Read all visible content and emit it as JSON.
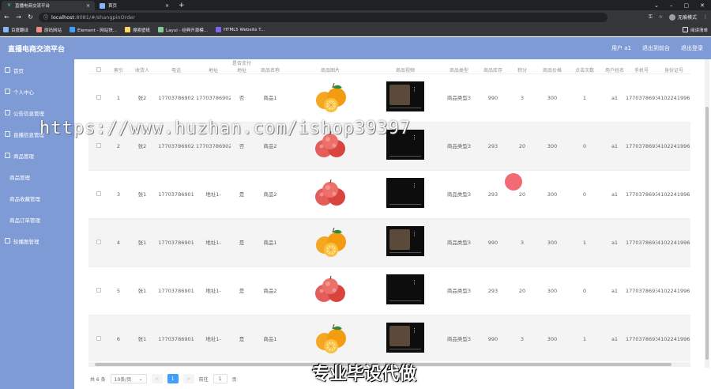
{
  "browser": {
    "tabs": [
      {
        "title": "直播电商交流平台",
        "active": true
      },
      {
        "title": "首页",
        "active": false
      }
    ],
    "url_host": "localhost",
    "url_path": ":8081/#/shangpinOrder",
    "profile_label": "无痕模式",
    "bookmarks": [
      "百度翻译",
      "原码网站",
      "Element - 网站快...",
      "搜索壁纸",
      "Layui - 经典开源模...",
      "HTML5 Website T..."
    ],
    "reading_list": "阅读清单"
  },
  "header": {
    "title": "直播电商交流平台",
    "links": [
      "用户 a1",
      "退出到前台",
      "退出登录"
    ]
  },
  "sidebar": {
    "items": [
      {
        "label": "首页",
        "sub": false
      },
      {
        "label": "个人中心",
        "sub": false
      },
      {
        "label": "公告信息管理",
        "sub": false
      },
      {
        "label": "直播信息管理",
        "sub": false
      },
      {
        "label": "商品管理",
        "sub": false
      },
      {
        "label": "商品管理",
        "sub": true
      },
      {
        "label": "商品收藏管理",
        "sub": true
      },
      {
        "label": "商品订单管理",
        "sub": true
      },
      {
        "label": "轮播图管理",
        "sub": false
      }
    ]
  },
  "table": {
    "columns": [
      "",
      "索引",
      "收货人",
      "电话",
      "地址",
      "是否支付地址",
      "商品名称",
      "商品图片",
      "商品视频",
      "商品类型",
      "商品库存",
      "积分",
      "商品价格",
      "点击次数",
      "用户姓名",
      "手机号",
      "身份证号"
    ],
    "rows": [
      {
        "idx": "1",
        "name": "张2",
        "phone": "17703786902",
        "addr": "17703786902",
        "paid": "否",
        "product": "商品1",
        "img": "orange",
        "type": "商品类型3",
        "stock": "990",
        "points": "3",
        "price": "300",
        "clicks": "1",
        "user": "a1",
        "mobile": "17703786931",
        "idcard": "410224199610232001"
      },
      {
        "idx": "2",
        "name": "张2",
        "phone": "17703786902",
        "addr": "17703786902",
        "paid": "否",
        "product": "商品2",
        "img": "apple",
        "type": "商品类型3",
        "stock": "293",
        "points": "20",
        "price": "300",
        "clicks": "0",
        "user": "a1",
        "mobile": "17703786931",
        "idcard": "410224199610232001"
      },
      {
        "idx": "3",
        "name": "张1",
        "phone": "17703786901",
        "addr": "地址1-",
        "paid": "是",
        "product": "商品2",
        "img": "apple",
        "type": "商品类型3",
        "stock": "293",
        "points": "20",
        "price": "300",
        "clicks": "0",
        "user": "a1",
        "mobile": "17703786931",
        "idcard": "410224199610232001"
      },
      {
        "idx": "4",
        "name": "张1",
        "phone": "17703786901",
        "addr": "地址1-",
        "paid": "是",
        "product": "商品1",
        "img": "orange",
        "type": "商品类型3",
        "stock": "990",
        "points": "3",
        "price": "300",
        "clicks": "1",
        "user": "a1",
        "mobile": "17703786931",
        "idcard": "410224199610232001"
      },
      {
        "idx": "5",
        "name": "张1",
        "phone": "17703786901",
        "addr": "地址1-",
        "paid": "是",
        "product": "商品2",
        "img": "apple",
        "type": "商品类型3",
        "stock": "293",
        "points": "20",
        "price": "300",
        "clicks": "0",
        "user": "a1",
        "mobile": "17703786931",
        "idcard": "410224199610232001"
      },
      {
        "idx": "6",
        "name": "张1",
        "phone": "17703786901",
        "addr": "地址1-",
        "paid": "是",
        "product": "商品1",
        "img": "orange",
        "type": "商品类型3",
        "stock": "990",
        "points": "3",
        "price": "300",
        "clicks": "1",
        "user": "a1",
        "mobile": "17703786931",
        "idcard": "410224199610232001"
      }
    ]
  },
  "pager": {
    "total": "共 6 条",
    "page_size": "10条/页",
    "prev": "<",
    "current": "1",
    "next": ">",
    "goto": "前往",
    "goto_value": "1",
    "page_unit": "页"
  },
  "overlays": {
    "watermark": "https://www.huzhan.com/ishop39397",
    "caption": "专业毕设代做"
  },
  "colors": {
    "sidebar": "#7f9bd6",
    "primary": "#409eff"
  }
}
